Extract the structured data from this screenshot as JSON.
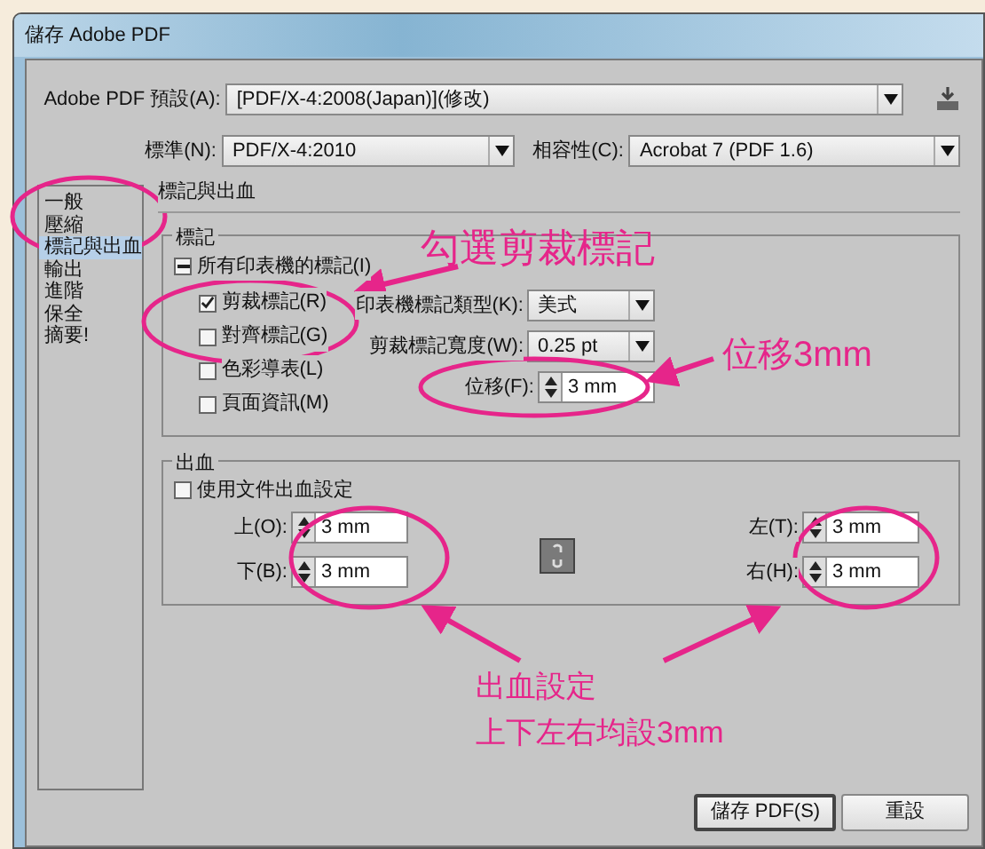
{
  "window": {
    "title": "儲存 Adobe PDF"
  },
  "preset": {
    "label": "Adobe PDF 預設(A):",
    "value": "[PDF/X-4:2008(Japan)](修改)"
  },
  "standard": {
    "label": "標準(N):",
    "value": "PDF/X-4:2010"
  },
  "compatibility": {
    "label": "相容性(C):",
    "value": "Acrobat 7 (PDF 1.6)"
  },
  "sidebar": {
    "items": [
      {
        "label": "一般",
        "selected": false
      },
      {
        "label": "壓縮",
        "selected": false
      },
      {
        "label": "標記與出血",
        "selected": true
      },
      {
        "label": "輸出",
        "selected": false
      },
      {
        "label": "進階",
        "selected": false
      },
      {
        "label": "保全",
        "selected": false
      },
      {
        "label": "摘要!",
        "selected": false
      }
    ]
  },
  "section_title": "標記與出血",
  "marks": {
    "title": "標記",
    "all_marks": {
      "label": "所有印表機的標記(I)",
      "indeterminate": true
    },
    "options": [
      {
        "label": "剪裁標記(R)",
        "checked": true
      },
      {
        "label": "對齊標記(G)",
        "checked": false
      },
      {
        "label": "色彩導表(L)",
        "checked": false
      },
      {
        "label": "頁面資訊(M)",
        "checked": false
      }
    ],
    "type": {
      "label": "印表機標記類型(K):",
      "value": "美式"
    },
    "weight": {
      "label": "剪裁標記寬度(W):",
      "value": "0.25 pt"
    },
    "offset": {
      "label": "位移(F):",
      "value": "3 mm"
    }
  },
  "bleed": {
    "title": "出血",
    "use_document": {
      "label": "使用文件出血設定",
      "checked": false
    },
    "left_fields": [
      {
        "label": "上(O):",
        "value": "3 mm"
      },
      {
        "label": "下(B):",
        "value": "3 mm"
      }
    ],
    "right_fields": [
      {
        "label": "左(T):",
        "value": "3 mm"
      },
      {
        "label": "右(H):",
        "value": "3 mm"
      }
    ]
  },
  "buttons": [
    {
      "label": "儲存 PDF(S)",
      "default": true
    },
    {
      "label": "重設",
      "default": false
    }
  ],
  "annotations": [
    {
      "text": "勾選剪裁標記",
      "kind": "title"
    },
    {
      "text": "位移3mm",
      "kind": "offset"
    },
    {
      "text": "出血設定",
      "kind": "bleed1"
    },
    {
      "text": "上下左右均設3mm",
      "kind": "bleed2"
    }
  ]
}
